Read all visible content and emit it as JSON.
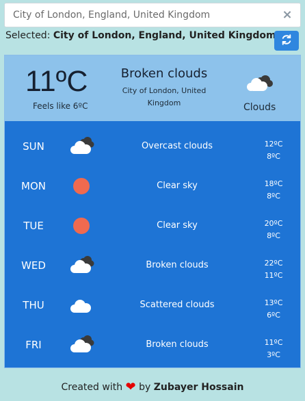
{
  "search": {
    "value": "City of London, England, United Kingdom",
    "clear_icon": "close-icon"
  },
  "selected": {
    "label": "Selected:",
    "value": "City of London, England, United Kingdom"
  },
  "refresh_icon": "refresh-icon",
  "current": {
    "temperature": "11ºC",
    "feels_like": "Feels like 6ºC",
    "condition": "Broken clouds",
    "location": "City of London, United Kingdom",
    "icon_label": "Clouds",
    "icon": "broken-clouds-icon"
  },
  "forecast": [
    {
      "day": "SUN",
      "icon": "overcast-clouds-icon",
      "description": "Overcast clouds",
      "high": "12ºC",
      "low": "8ºC"
    },
    {
      "day": "MON",
      "icon": "clear-sky-icon",
      "description": "Clear sky",
      "high": "18ºC",
      "low": "8ºC"
    },
    {
      "day": "TUE",
      "icon": "clear-sky-icon",
      "description": "Clear sky",
      "high": "20ºC",
      "low": "8ºC"
    },
    {
      "day": "WED",
      "icon": "broken-clouds-icon",
      "description": "Broken clouds",
      "high": "22ºC",
      "low": "11ºC"
    },
    {
      "day": "THU",
      "icon": "scattered-clouds-icon",
      "description": "Scattered clouds",
      "high": "13ºC",
      "low": "6ºC"
    },
    {
      "day": "FRI",
      "icon": "broken-clouds-icon",
      "description": "Broken clouds",
      "high": "11ºC",
      "low": "3ºC"
    }
  ],
  "footer": {
    "prefix": "Created with",
    "by": "by",
    "author": "Zubayer Hossain",
    "heart_icon": "heart-icon"
  },
  "colors": {
    "background": "#b8e2e3",
    "card": "#1e74d5",
    "current_panel": "#8dc2eb",
    "sun": "#f06a4f",
    "refresh_button": "#2f86df"
  }
}
